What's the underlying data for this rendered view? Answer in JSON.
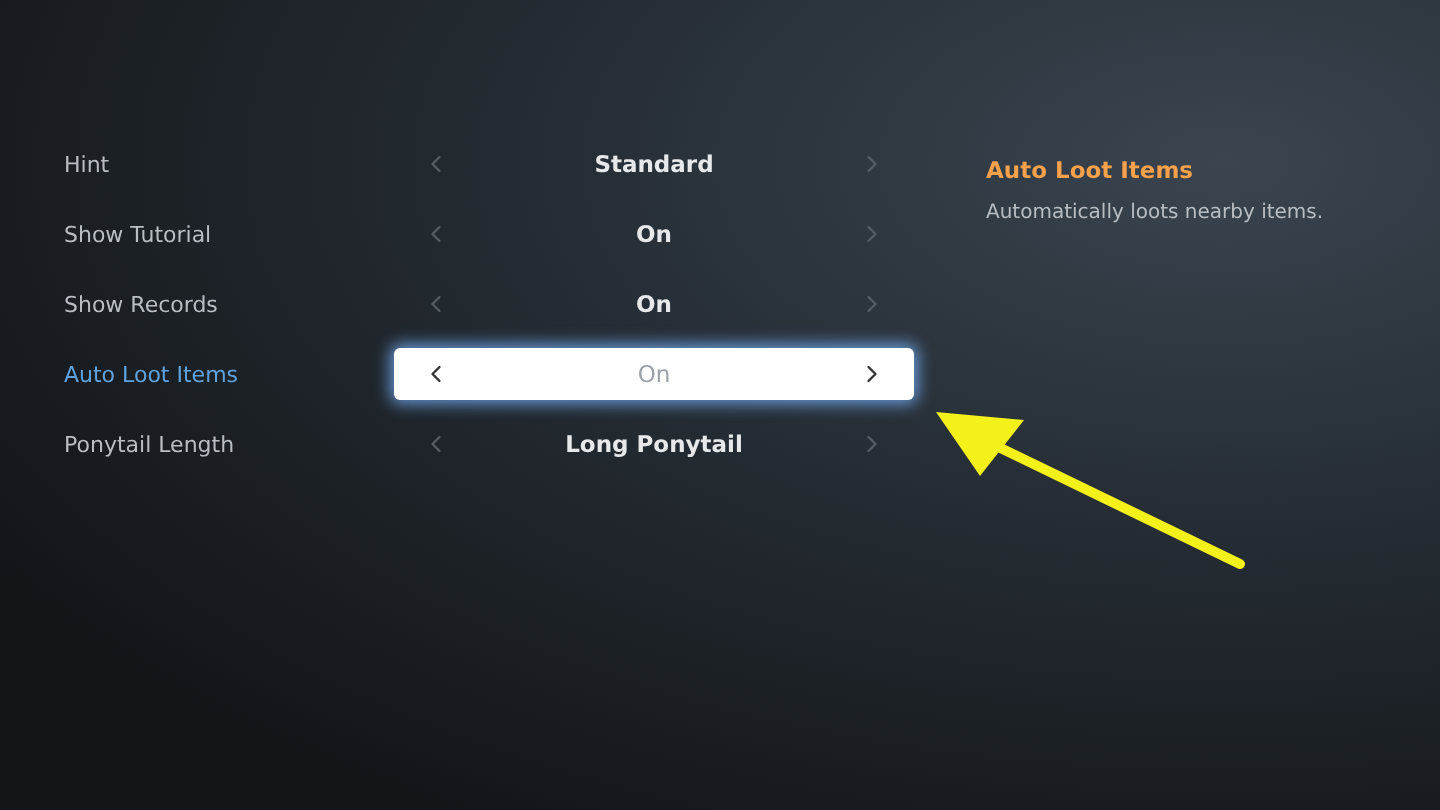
{
  "settings": [
    {
      "label": "Hint",
      "value": "Standard",
      "selected": false
    },
    {
      "label": "Show Tutorial",
      "value": "On",
      "selected": false
    },
    {
      "label": "Show Records",
      "value": "On",
      "selected": false
    },
    {
      "label": "Auto Loot Items",
      "value": "On",
      "selected": true
    },
    {
      "label": "Ponytail Length",
      "value": "Long Ponytail",
      "selected": false
    }
  ],
  "description": {
    "title": "Auto Loot Items",
    "text": "Automatically loots nearby items."
  }
}
